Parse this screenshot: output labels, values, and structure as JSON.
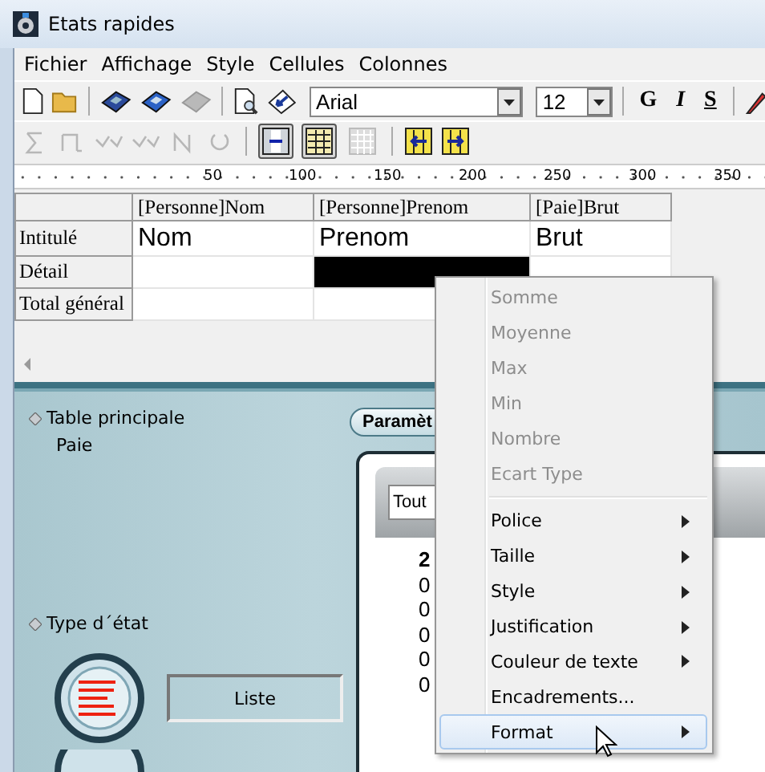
{
  "window": {
    "title": "Etats rapides"
  },
  "menu": [
    {
      "label": "Fichier"
    },
    {
      "label": "Affichage"
    },
    {
      "label": "Style"
    },
    {
      "label": "Cellules"
    },
    {
      "label": "Colonnes"
    }
  ],
  "toolbar": {
    "font": "Arial",
    "size": "12",
    "format_buttons": [
      "G",
      "I",
      "S"
    ]
  },
  "toolbar2": [
    {
      "disabled": true
    },
    {
      "disabled": true
    },
    {
      "disabled": true
    },
    {
      "disabled": true
    },
    {
      "disabled": true
    },
    {
      "disabled": true
    }
  ],
  "view_toggles": [
    {
      "selected": true
    },
    {
      "selected": true
    },
    {
      "selected": false
    }
  ],
  "ruler": [
    "50",
    "100",
    "150",
    "200",
    "250",
    "300",
    "350"
  ],
  "grid": {
    "columns": [
      "[Personne]Nom",
      "[Personne]Prenom",
      "[Paie]Brut"
    ],
    "rows": [
      {
        "label": "Intitulé",
        "cells": [
          {
            "text": "Nom",
            "selected": false
          },
          {
            "text": "Prenom",
            "selected": false
          },
          {
            "text": "Brut",
            "selected": false
          }
        ]
      },
      {
        "label": "Détail",
        "cells": [
          {
            "selected": false
          },
          {
            "selected": true
          },
          {
            "selected": false
          }
        ]
      },
      {
        "label": "Total général",
        "cells": [
          {
            "selected": false
          },
          {
            "selected": false
          }
        ]
      }
    ]
  },
  "panel": {
    "table_label": "Table principale",
    "table_value": "Paie",
    "type_label": "Type d´état",
    "type_value": "Liste",
    "tab": "Paramèt",
    "dropdown": "Tout",
    "list": [
      "2",
      "0",
      "0",
      "0",
      "0",
      "0"
    ]
  },
  "context_menu": [
    {
      "kind": "command",
      "label": "Somme",
      "disabled": true,
      "submenu": false,
      "selected": false
    },
    {
      "kind": "command",
      "label": "Moyenne",
      "disabled": true,
      "submenu": false,
      "selected": false
    },
    {
      "kind": "command",
      "label": "Max",
      "disabled": true,
      "submenu": false,
      "selected": false
    },
    {
      "kind": "command",
      "label": "Min",
      "disabled": true,
      "submenu": false,
      "selected": false
    },
    {
      "kind": "command",
      "label": "Nombre",
      "disabled": true,
      "submenu": false,
      "selected": false
    },
    {
      "kind": "command",
      "label": "Ecart Type",
      "disabled": true,
      "submenu": false,
      "selected": false
    },
    {
      "kind": "separator"
    },
    {
      "kind": "command",
      "label": "Police",
      "disabled": false,
      "submenu": true,
      "selected": false
    },
    {
      "kind": "command",
      "label": "Taille",
      "disabled": false,
      "submenu": true,
      "selected": false
    },
    {
      "kind": "command",
      "label": "Style",
      "disabled": false,
      "submenu": true,
      "selected": false
    },
    {
      "kind": "command",
      "label": "Justification",
      "disabled": false,
      "submenu": true,
      "selected": false
    },
    {
      "kind": "command",
      "label": "Couleur de texte",
      "disabled": false,
      "submenu": true,
      "selected": false
    },
    {
      "kind": "command",
      "label": "Encadrements...",
      "disabled": false,
      "submenu": false,
      "selected": false
    },
    {
      "kind": "command",
      "label": "Format",
      "disabled": false,
      "submenu": true,
      "selected": true
    }
  ]
}
